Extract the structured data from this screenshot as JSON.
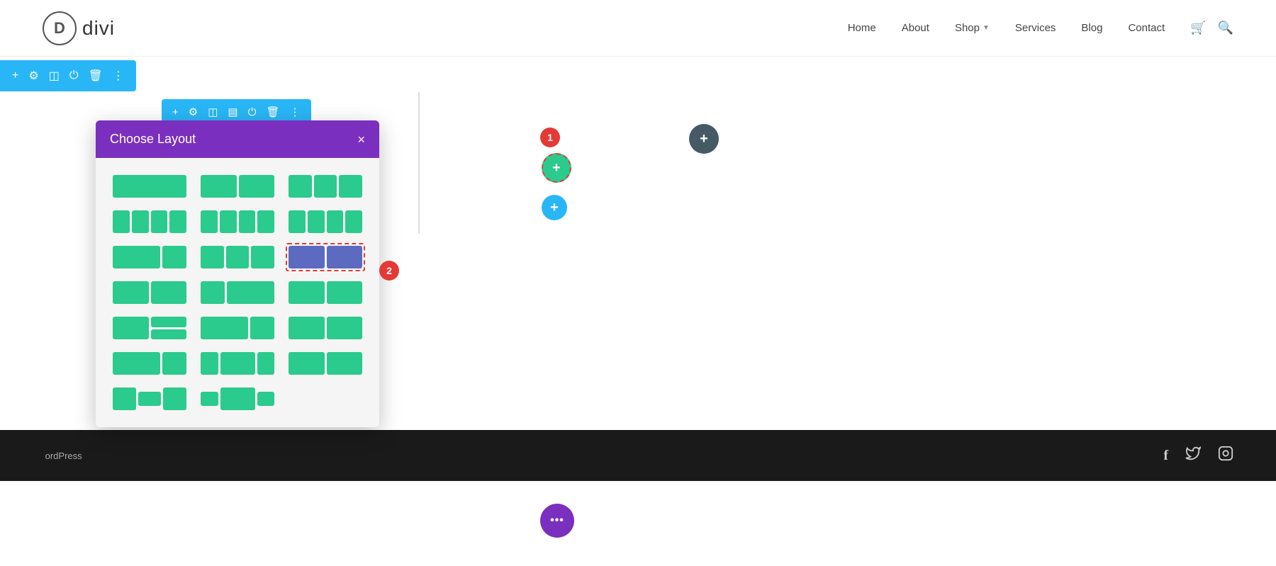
{
  "header": {
    "logo_letter": "D",
    "logo_name": "divi",
    "nav": [
      {
        "label": "Home",
        "has_dropdown": false
      },
      {
        "label": "About",
        "has_dropdown": false
      },
      {
        "label": "Shop",
        "has_dropdown": true
      },
      {
        "label": "Services",
        "has_dropdown": true
      },
      {
        "label": "Blog",
        "has_dropdown": false
      },
      {
        "label": "Contact",
        "has_dropdown": false
      }
    ]
  },
  "top_toolbar": {
    "icons": [
      "+",
      "⚙",
      "⊞",
      "⏻",
      "🗑",
      "⋮"
    ]
  },
  "section_toolbar": {
    "icons": [
      "+",
      "⚙",
      "⊞",
      "⊟",
      "⏻",
      "🗑",
      "⋮"
    ]
  },
  "layout_dialog": {
    "title": "Choose Layout",
    "close_label": "×"
  },
  "footer": {
    "text": "ordPress",
    "social_icons": [
      "f",
      "t",
      "◻"
    ]
  },
  "buttons": {
    "add_dark": "+",
    "add_green": "+",
    "add_blue": "+",
    "add_purple": "···"
  },
  "badges": {
    "one": "1",
    "two": "2"
  },
  "colors": {
    "teal": "#2bca8d",
    "purple": "#7b2fbe",
    "blue_accent": "#29b6f6",
    "dark_bg": "#1a1a1a",
    "red_badge": "#e53935",
    "indigo": "#5c6bc0"
  }
}
